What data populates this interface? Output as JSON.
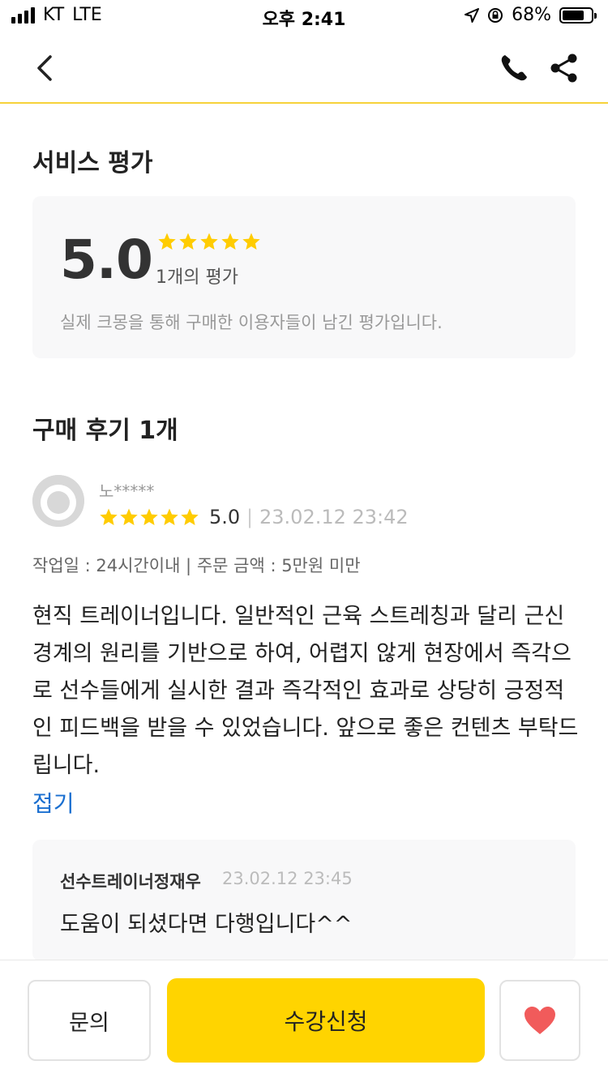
{
  "status_bar": {
    "carrier": "KT",
    "network": "LTE",
    "time": "오후 2:41",
    "battery": "68%"
  },
  "nav": {
    "back_icon": "chevron-left-icon",
    "phone_icon": "phone-icon",
    "share_icon": "share-icon"
  },
  "service_rating": {
    "title": "서비스 평가",
    "score": "5.0",
    "stars": 5,
    "count_label": "1개의 평가",
    "note": "실제 크몽을 통해 구매한 이용자들이 남긴 평가입니다."
  },
  "reviews_section": {
    "title": "구매 후기 1개",
    "review": {
      "author": "노*****",
      "stars": 5,
      "score": "5.0",
      "separator": "|",
      "date": "23.02.12 23:42",
      "meta": "작업일 : 24시간이내 | 주문 금액 : 5만원 미만",
      "text": "현직 트레이너입니다. 일반적인 근육 스트레칭과 달리 근신경계의 원리를 기반으로 하여, 어렵지 않게 현장에서 즉각으로 선수들에게 실시한 결과 즉각적인 효과로 상당히 긍정적인 피드백을 받을 수 있었습니다.  앞으로 좋은 컨텐츠 부탁드립니다.",
      "collapse_label": "접기",
      "reply": {
        "author": "선수트레이너정재우",
        "date": "23.02.12 23:45",
        "text": "도움이 되셨다면 다행입니다^^"
      }
    }
  },
  "bottom_bar": {
    "inquiry_label": "문의",
    "apply_label": "수강신청",
    "like_icon": "heart-icon"
  },
  "colors": {
    "accent": "#ffd400",
    "star": "#ffcc00",
    "link": "#1a6fd0",
    "like": "#f15b5b"
  }
}
